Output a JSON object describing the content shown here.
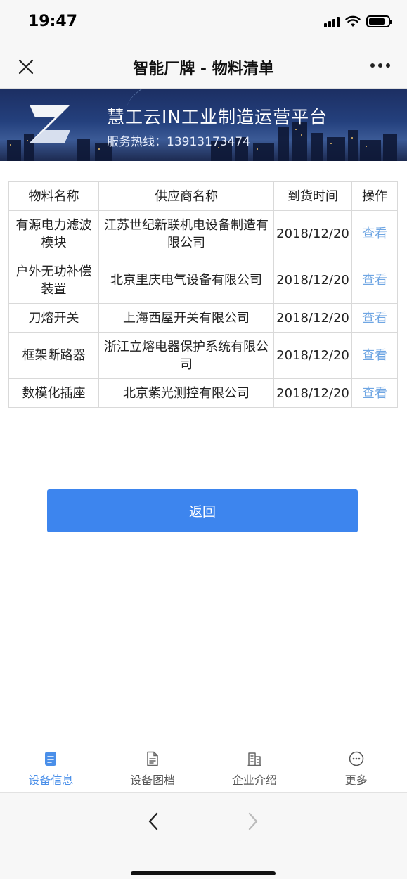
{
  "status_bar": {
    "time": "19:47",
    "battery_level": 0.85
  },
  "navbar": {
    "title": "智能厂牌 - 物料清单",
    "close_icon": "close-icon",
    "more_icon": "more-icon"
  },
  "banner": {
    "slogan": "慧工云IN工业制造运营平台",
    "hotline": "服务热线：13913173474"
  },
  "table": {
    "headers": [
      "物料名称",
      "供应商名称",
      "到货时间",
      "操作"
    ],
    "rows": [
      {
        "name": "有源电力滤波模块",
        "supplier": "江苏世纪新联机电设备制造有限公司",
        "date": "2018/12/20",
        "action": "查看"
      },
      {
        "name": "户外无功补偿装置",
        "supplier": "北京里庆电气设备有限公司",
        "date": "2018/12/20",
        "action": "查看"
      },
      {
        "name": "刀熔开关",
        "supplier": "上海西屋开关有限公司",
        "date": "2018/12/20",
        "action": "查看"
      },
      {
        "name": "框架断路器",
        "supplier": "浙江立熔电器保护系统有限公司",
        "date": "2018/12/20",
        "action": "查看"
      },
      {
        "name": "数模化插座",
        "supplier": "北京紫光测控有限公司",
        "date": "2018/12/20",
        "action": "查看"
      }
    ]
  },
  "back_button": {
    "label": "返回"
  },
  "tabbar": {
    "items": [
      {
        "label": "设备信息",
        "icon": "document-filled-icon",
        "active": true
      },
      {
        "label": "设备图档",
        "icon": "document-outline-icon",
        "active": false
      },
      {
        "label": "企业介绍",
        "icon": "building-icon",
        "active": false
      },
      {
        "label": "更多",
        "icon": "more-circle-icon",
        "active": false
      }
    ]
  },
  "colors": {
    "accent": "#3d85ee",
    "link": "#6fa6e3",
    "tab_active": "#4a8fe9"
  }
}
